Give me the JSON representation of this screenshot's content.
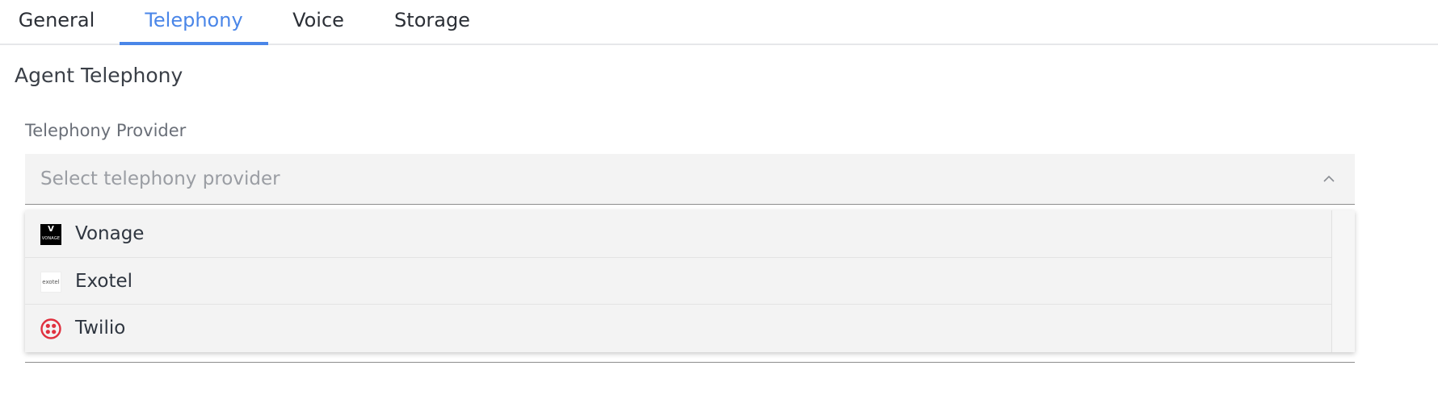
{
  "tabs": [
    {
      "label": "General",
      "active": false
    },
    {
      "label": "Telephony",
      "active": true
    },
    {
      "label": "Voice",
      "active": false
    },
    {
      "label": "Storage",
      "active": false
    }
  ],
  "section": {
    "title": "Agent Telephony"
  },
  "telephony_provider": {
    "label": "Telephony Provider",
    "placeholder": "Select telephony provider",
    "expanded": true,
    "options": [
      {
        "label": "Vonage",
        "icon": "vonage-logo-icon",
        "logo_text": [
          "V",
          "VONAGE"
        ]
      },
      {
        "label": "Exotel",
        "icon": "exotel-logo-icon",
        "logo_text": "exotel"
      },
      {
        "label": "Twilio",
        "icon": "twilio-logo-icon"
      }
    ]
  },
  "colors": {
    "accent": "#4a86e8",
    "field_bg": "#f3f3f3",
    "twilio_red": "#e0313f"
  }
}
